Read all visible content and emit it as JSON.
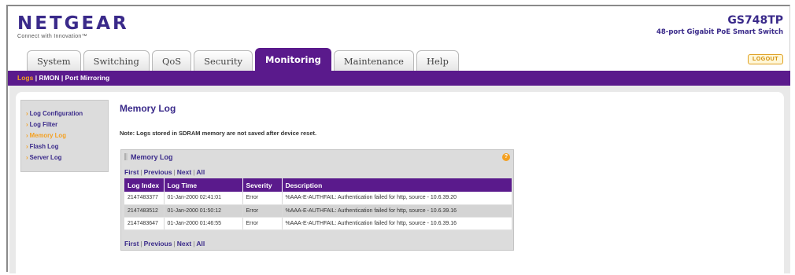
{
  "header": {
    "brand": "NETGEAR",
    "tagline": "Connect with Innovation™",
    "model": "GS748TP",
    "model_description": "48-port Gigabit PoE Smart Switch",
    "logout_label": "LOGOUT"
  },
  "tabs": [
    {
      "label": "System"
    },
    {
      "label": "Switching"
    },
    {
      "label": "QoS"
    },
    {
      "label": "Security"
    },
    {
      "label": "Monitoring",
      "active": true
    },
    {
      "label": "Maintenance"
    },
    {
      "label": "Help"
    }
  ],
  "subnav": {
    "items": [
      "Logs",
      "RMON",
      "Port Mirroring"
    ],
    "separator": "|"
  },
  "sidebar": {
    "items": [
      {
        "label": "Log Configuration"
      },
      {
        "label": "Log Filter"
      },
      {
        "label": "Memory Log",
        "active": true
      },
      {
        "label": "Flash Log"
      },
      {
        "label": "Server Log"
      }
    ]
  },
  "main": {
    "title": "Memory Log",
    "note": "Note: Logs stored in SDRAM memory are not saved after device reset.",
    "panel_title": "Memory Log",
    "pager": {
      "first": "First",
      "previous": "Previous",
      "next": "Next",
      "all": "All",
      "separator": "|"
    },
    "table": {
      "columns": [
        "Log Index",
        "Log Time",
        "Severity",
        "Description"
      ],
      "rows": [
        {
          "index": "2147483377",
          "time": "01-Jan-2000 02:41:01",
          "severity": "Error",
          "description": "%AAA-E-AUTHFAIL: Authentication failed for http, source - 10.6.39.20"
        },
        {
          "index": "2147483512",
          "time": "01-Jan-2000 01:50:12",
          "severity": "Error",
          "description": "%AAA-E-AUTHFAIL: Authentication failed for http, source - 10.6.39.16"
        },
        {
          "index": "2147483647",
          "time": "01-Jan-2000 01:46:55",
          "severity": "Error",
          "description": "%AAA-E-AUTHFAIL: Authentication failed for http, source - 10.6.39.16"
        }
      ]
    }
  },
  "colors": {
    "brand_purple": "#5a1a8c",
    "link_blue": "#3a2a8a",
    "accent_orange": "#f4a020"
  }
}
